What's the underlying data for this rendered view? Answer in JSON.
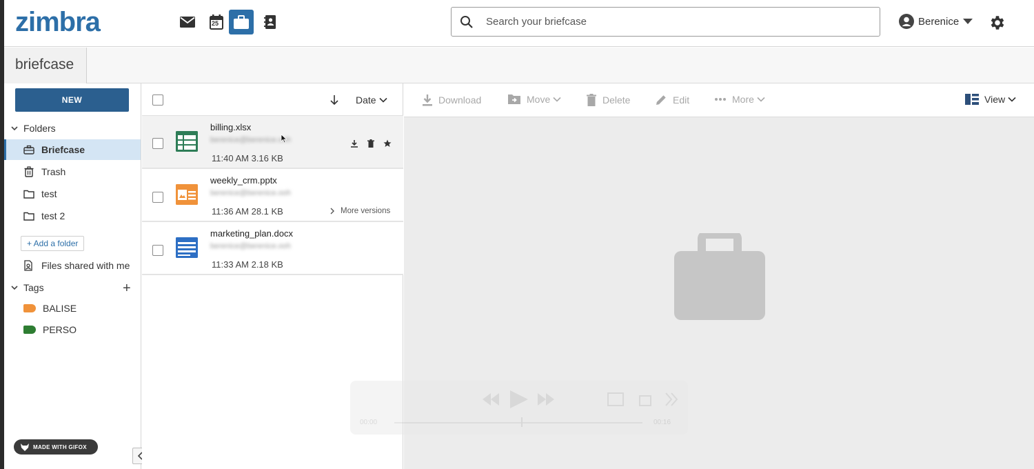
{
  "topbar": {
    "logo": "zimbra",
    "apps": [
      {
        "name": "mail-icon"
      },
      {
        "name": "calendar-icon",
        "label": "25"
      },
      {
        "name": "briefcase-icon"
      },
      {
        "name": "contacts-icon"
      }
    ],
    "search_placeholder": "Search your briefcase",
    "user_name": "Berenice",
    "accent": "#2d6fa8"
  },
  "band": {
    "tab_label": "briefcase"
  },
  "sidebar": {
    "new_label": "NEW",
    "folders_label": "Folders",
    "folders": [
      {
        "label": "Briefcase",
        "icon": "briefcase-icon",
        "selected": true
      },
      {
        "label": "Trash",
        "icon": "trash-icon"
      },
      {
        "label": "test",
        "icon": "folder-icon"
      },
      {
        "label": "test 2",
        "icon": "folder-icon"
      }
    ],
    "add_folder_label": "+ Add a folder",
    "shared_label": "Files shared with me",
    "tags_label": "Tags",
    "tags": [
      {
        "label": "BALISE",
        "color": "#f0923a"
      },
      {
        "label": "PERSO",
        "color": "#2e7d32"
      }
    ],
    "gifox_label": "MADE WITH GIFOX"
  },
  "list": {
    "sort_label": "Date",
    "files": [
      {
        "name": "billing.xlsx",
        "owner": "berenice@berenice.ooh",
        "time": "11:40 AM",
        "size": "3.16 KB",
        "type": "spreadsheet",
        "color": "#2e7d57"
      },
      {
        "name": "weekly_crm.pptx",
        "owner": "berenice@berenice.ooh",
        "time": "11:36 AM",
        "size": "28.1 KB",
        "type": "presentation",
        "color": "#f0923a",
        "more_versions": "More versions"
      },
      {
        "name": "marketing_plan.docx",
        "owner": "berenice@berenice.ooh",
        "time": "11:33 AM",
        "size": "2.18 KB",
        "type": "document",
        "color": "#2d6fc4"
      }
    ]
  },
  "toolbar": {
    "download": "Download",
    "move": "Move",
    "delete": "Delete",
    "edit": "Edit",
    "more": "More",
    "view": "View"
  },
  "player": {
    "time_start": "00:00",
    "time_end": "00:16"
  }
}
